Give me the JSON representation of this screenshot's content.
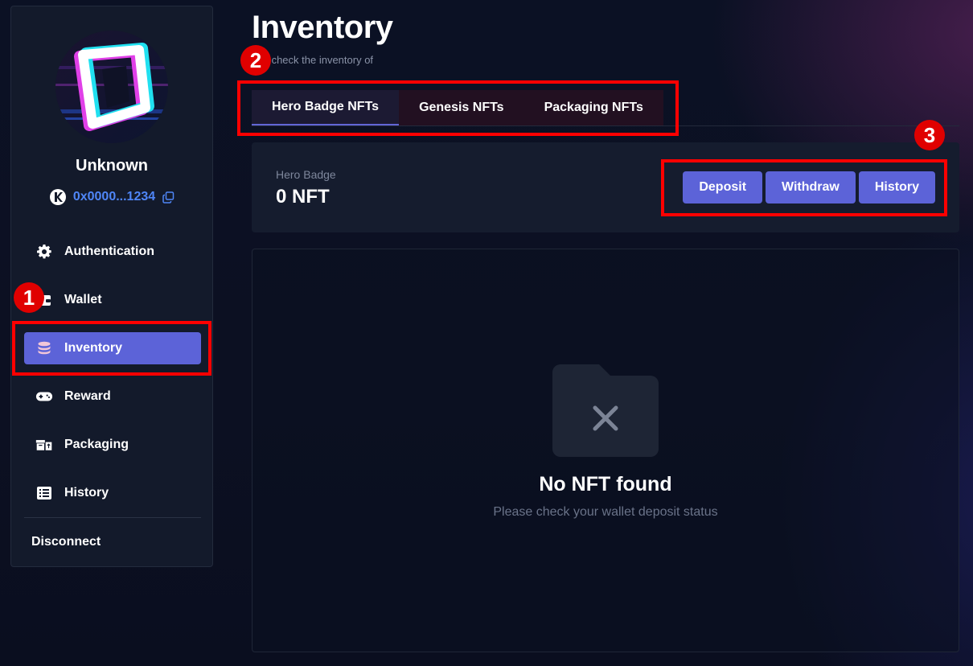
{
  "sidebar": {
    "username": "Unknown",
    "wallet_address": "0x0000...1234",
    "chain_icon": "kaia-chain-icon",
    "copy_icon": "copy-icon",
    "items": [
      {
        "label": "Authentication",
        "icon": "gear-icon"
      },
      {
        "label": "Wallet",
        "icon": "wallet-icon"
      },
      {
        "label": "Inventory",
        "icon": "database-icon",
        "active": true
      },
      {
        "label": "Reward",
        "icon": "gamepad-icon"
      },
      {
        "label": "Packaging",
        "icon": "box-icon"
      },
      {
        "label": "History",
        "icon": "list-icon"
      }
    ],
    "disconnect_label": "Disconnect"
  },
  "main": {
    "title": "Inventory",
    "subtitle": "ase check the inventory of",
    "tabs": [
      {
        "label": "Hero Badge NFTs",
        "active": true
      },
      {
        "label": "Genesis NFTs"
      },
      {
        "label": "Packaging NFTs"
      }
    ],
    "badge_card": {
      "label": "Hero Badge",
      "value": "0 NFT",
      "actions": {
        "deposit": "Deposit",
        "withdraw": "Withdraw",
        "history": "History"
      }
    },
    "empty_state": {
      "icon": "empty-folder-icon",
      "title": "No NFT found",
      "subtitle": "Please check your wallet deposit status"
    }
  },
  "annotations": [
    "1",
    "2",
    "3"
  ],
  "colors": {
    "accent": "#5c63d8",
    "link": "#4f86f7",
    "annotation": "#ff0000"
  }
}
